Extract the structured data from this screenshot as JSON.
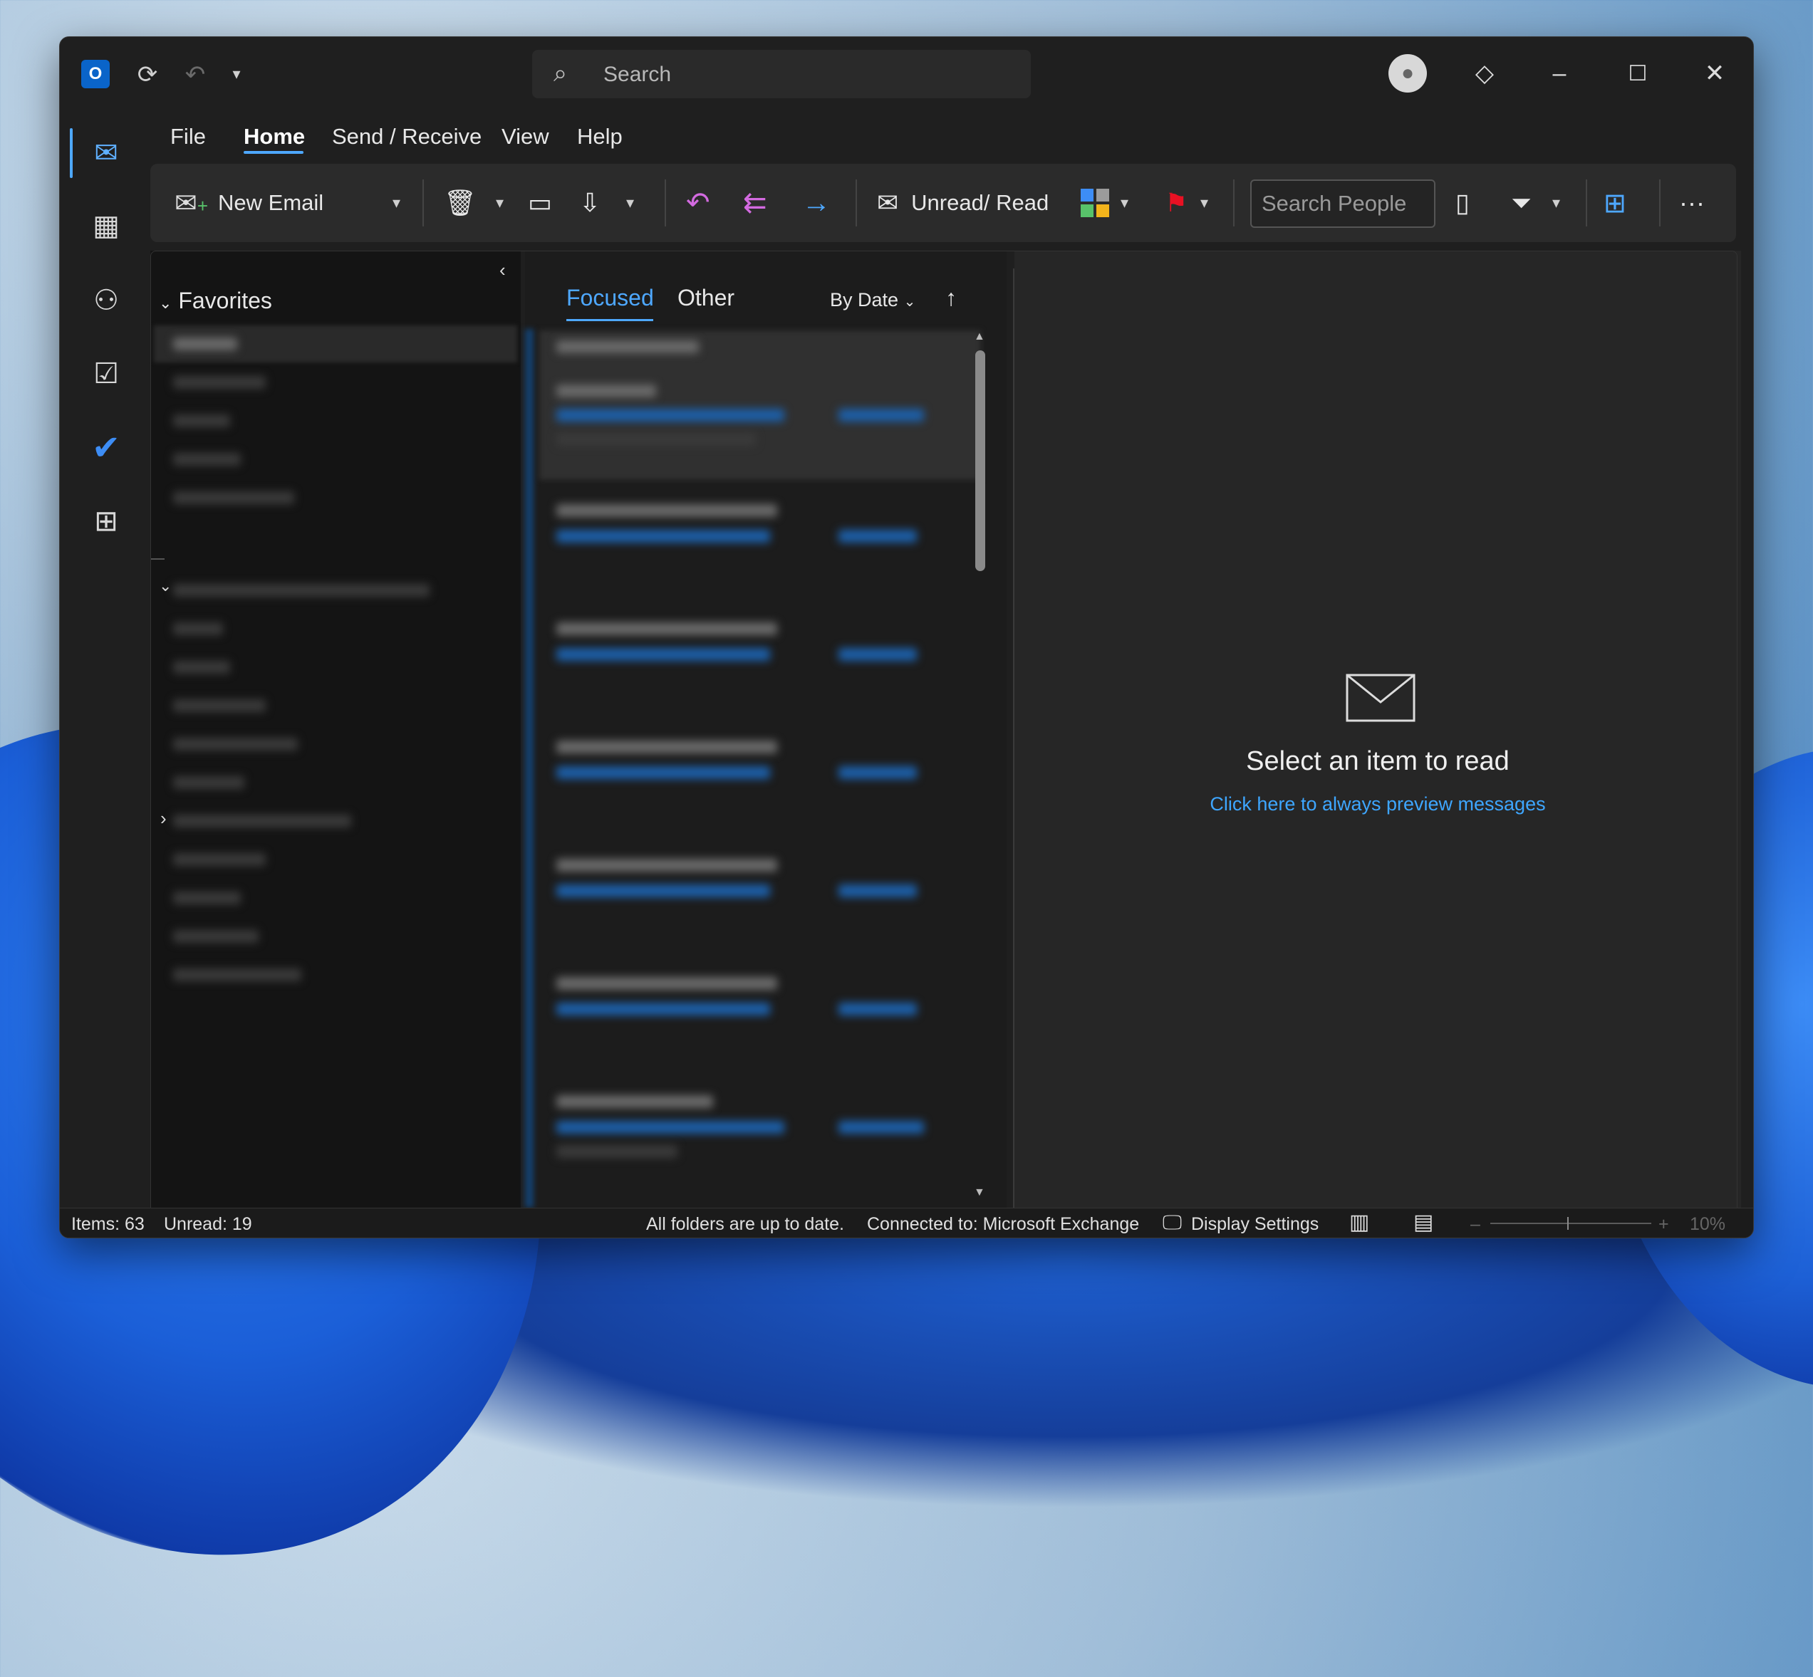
{
  "titlebar": {
    "app_icon_letter": "O",
    "search_placeholder": "Search"
  },
  "menu": {
    "items": [
      "File",
      "Home",
      "Send / Receive",
      "View",
      "Help"
    ],
    "active": "Home"
  },
  "ribbon": {
    "new_email": "New Email",
    "unread_read": "Unread/ Read",
    "search_people_placeholder": "Search People"
  },
  "folders": {
    "favorites_label": "Favorites"
  },
  "message_list": {
    "tab_focused": "Focused",
    "tab_other": "Other",
    "sort_label": "By Date"
  },
  "reading_pane": {
    "empty_title": "Select an item to read",
    "preview_link": "Click here to always preview messages"
  },
  "status_bar": {
    "items": "Items: 63",
    "unread": "Unread: 19",
    "sync": "All folders are up to date.",
    "connection": "Connected to: Microsoft Exchange",
    "display_settings": "Display Settings",
    "zoom": "10%"
  },
  "colors": {
    "accent": "#4ea8ff",
    "link": "#3ea6ff",
    "flag": "#e81123",
    "reply": "#d36ae0",
    "forward": "#4ea8ff"
  },
  "icons": [
    "outlook-logo-icon",
    "sync-icon",
    "undo-icon",
    "customize-qat-icon",
    "search-icon",
    "avatar-icon",
    "premium-diamond-icon",
    "minimize-icon",
    "maximize-icon",
    "close-icon",
    "mail-icon",
    "calendar-icon",
    "people-icon",
    "tasks-icon",
    "todo-icon",
    "apps-icon",
    "envelope-icon"
  ]
}
